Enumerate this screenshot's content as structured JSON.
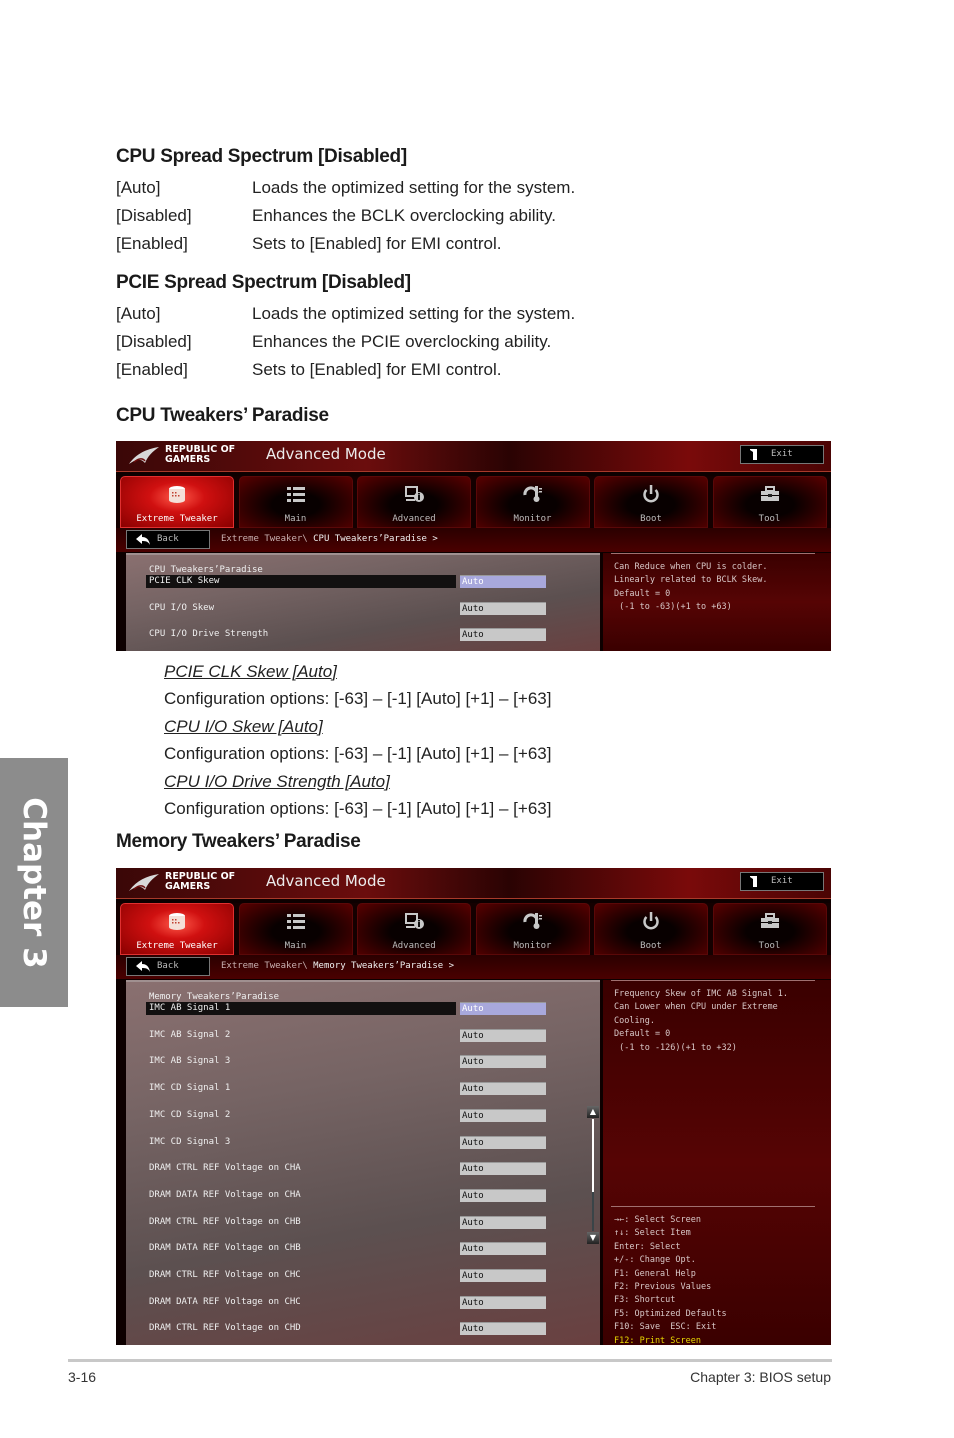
{
  "sections": {
    "cpu_spread": {
      "heading": "CPU Spread Spectrum [Disabled]",
      "options": [
        {
          "key": "[Auto]",
          "desc": "Loads the optimized setting for the system."
        },
        {
          "key": "[Disabled]",
          "desc": "Enhances the BCLK overclocking ability."
        },
        {
          "key": "[Enabled]",
          "desc": "Sets to [Enabled] for EMI control."
        }
      ]
    },
    "pcie_spread": {
      "heading": "PCIE Spread Spectrum [Disabled]",
      "options": [
        {
          "key": "[Auto]",
          "desc": "Loads the optimized setting for the system."
        },
        {
          "key": "[Disabled]",
          "desc": "Enhances the PCIE overclocking ability."
        },
        {
          "key": "[Enabled]",
          "desc": "Sets to [Enabled] for EMI control."
        }
      ]
    },
    "cpu_tweakers": {
      "heading": "CPU Tweakers’ Paradise",
      "items": [
        {
          "title": "PCIE CLK Skew [Auto]",
          "config": "Configuration options: [-63] – [-1] [Auto] [+1] – [+63]"
        },
        {
          "title": "CPU I/O Skew [Auto]",
          "config": "Configuration options: [-63] – [-1] [Auto] [+1] – [+63]"
        },
        {
          "title": "CPU I/O Drive Strength [Auto]",
          "config": "Configuration options: [-63] – [-1] [Auto] [+1] – [+63]"
        }
      ]
    },
    "memory_tweakers": {
      "heading": "Memory Tweakers’ Paradise"
    }
  },
  "bios_common": {
    "brand_line1": "REPUBLIC OF",
    "brand_line2": "GAMERS",
    "mode_title": "Advanced Mode",
    "exit_label": "Exit",
    "back_label": "Back",
    "tabs": [
      {
        "label": "Extreme Tweaker",
        "icon": "tweaker-icon",
        "active": true
      },
      {
        "label": "Main",
        "icon": "list-icon"
      },
      {
        "label": "Advanced",
        "icon": "advanced-icon"
      },
      {
        "label": "Monitor",
        "icon": "thermometer-icon"
      },
      {
        "label": "Boot",
        "icon": "power-icon"
      },
      {
        "label": "Tool",
        "icon": "toolbox-icon"
      }
    ],
    "accent_color": "#d01010",
    "selected_value_color": "#a8a8dc",
    "highlight_text_color": "#e8d800"
  },
  "bios1": {
    "breadcrumb_prefix": "Extreme Tweaker\\ ",
    "breadcrumb_current": "CPU Tweakers’Paradise >",
    "section_title": "CPU Tweakers’Paradise",
    "rows": [
      {
        "label": "PCIE CLK Skew",
        "value": "Auto",
        "selected": true
      },
      {
        "label": "CPU I/O Skew",
        "value": "Auto"
      },
      {
        "label": "CPU I/O Drive Strength",
        "value": "Auto"
      }
    ],
    "help": [
      "Can Reduce when CPU is colder.",
      "Linearly related to BCLK Skew.",
      "Default = 0",
      " (-1 to -63)(+1 to +63)"
    ]
  },
  "bios2": {
    "breadcrumb_prefix": "Extreme Tweaker\\ ",
    "breadcrumb_current": "Memory Tweakers’Paradise >",
    "section_title": "Memory Tweakers’Paradise",
    "rows": [
      {
        "label": "IMC AB Signal 1",
        "value": "Auto",
        "selected": true
      },
      {
        "label": "IMC AB Signal 2",
        "value": "Auto"
      },
      {
        "label": "IMC AB Signal 3",
        "value": "Auto"
      },
      {
        "label": "IMC CD Signal 1",
        "value": "Auto"
      },
      {
        "label": "IMC CD Signal 2",
        "value": "Auto"
      },
      {
        "label": "IMC CD Signal 3",
        "value": "Auto"
      },
      {
        "label": "DRAM CTRL REF Voltage on CHA",
        "value": "Auto"
      },
      {
        "label": "DRAM DATA REF Voltage on CHA",
        "value": "Auto"
      },
      {
        "label": "DRAM CTRL REF Voltage on CHB",
        "value": "Auto"
      },
      {
        "label": "DRAM DATA REF Voltage on CHB",
        "value": "Auto"
      },
      {
        "label": "DRAM CTRL REF Voltage on CHC",
        "value": "Auto"
      },
      {
        "label": "DRAM DATA REF Voltage on CHC",
        "value": "Auto"
      },
      {
        "label": "DRAM CTRL REF Voltage on CHD",
        "value": "Auto"
      }
    ],
    "help": [
      "Frequency Skew of IMC AB Signal 1.",
      "Can Lower when CPU under Extreme",
      "Cooling.",
      "Default = 0",
      " (-1 to -126)(+1 to +32)"
    ],
    "scroll_position": 0.65,
    "keys": [
      "→←: Select Screen",
      "↑↓: Select Item",
      "Enter: Select",
      "+/-: Change Opt.",
      "F1: General Help",
      "F2: Previous Values",
      "F3: Shortcut",
      "F5: Optimized Defaults",
      "F10: Save  ESC: Exit",
      "F12: Print Screen"
    ]
  },
  "chapter_tab": "Chapter 3",
  "footer": {
    "page_number": "3-16",
    "chapter_title": "Chapter 3: BIOS setup"
  }
}
